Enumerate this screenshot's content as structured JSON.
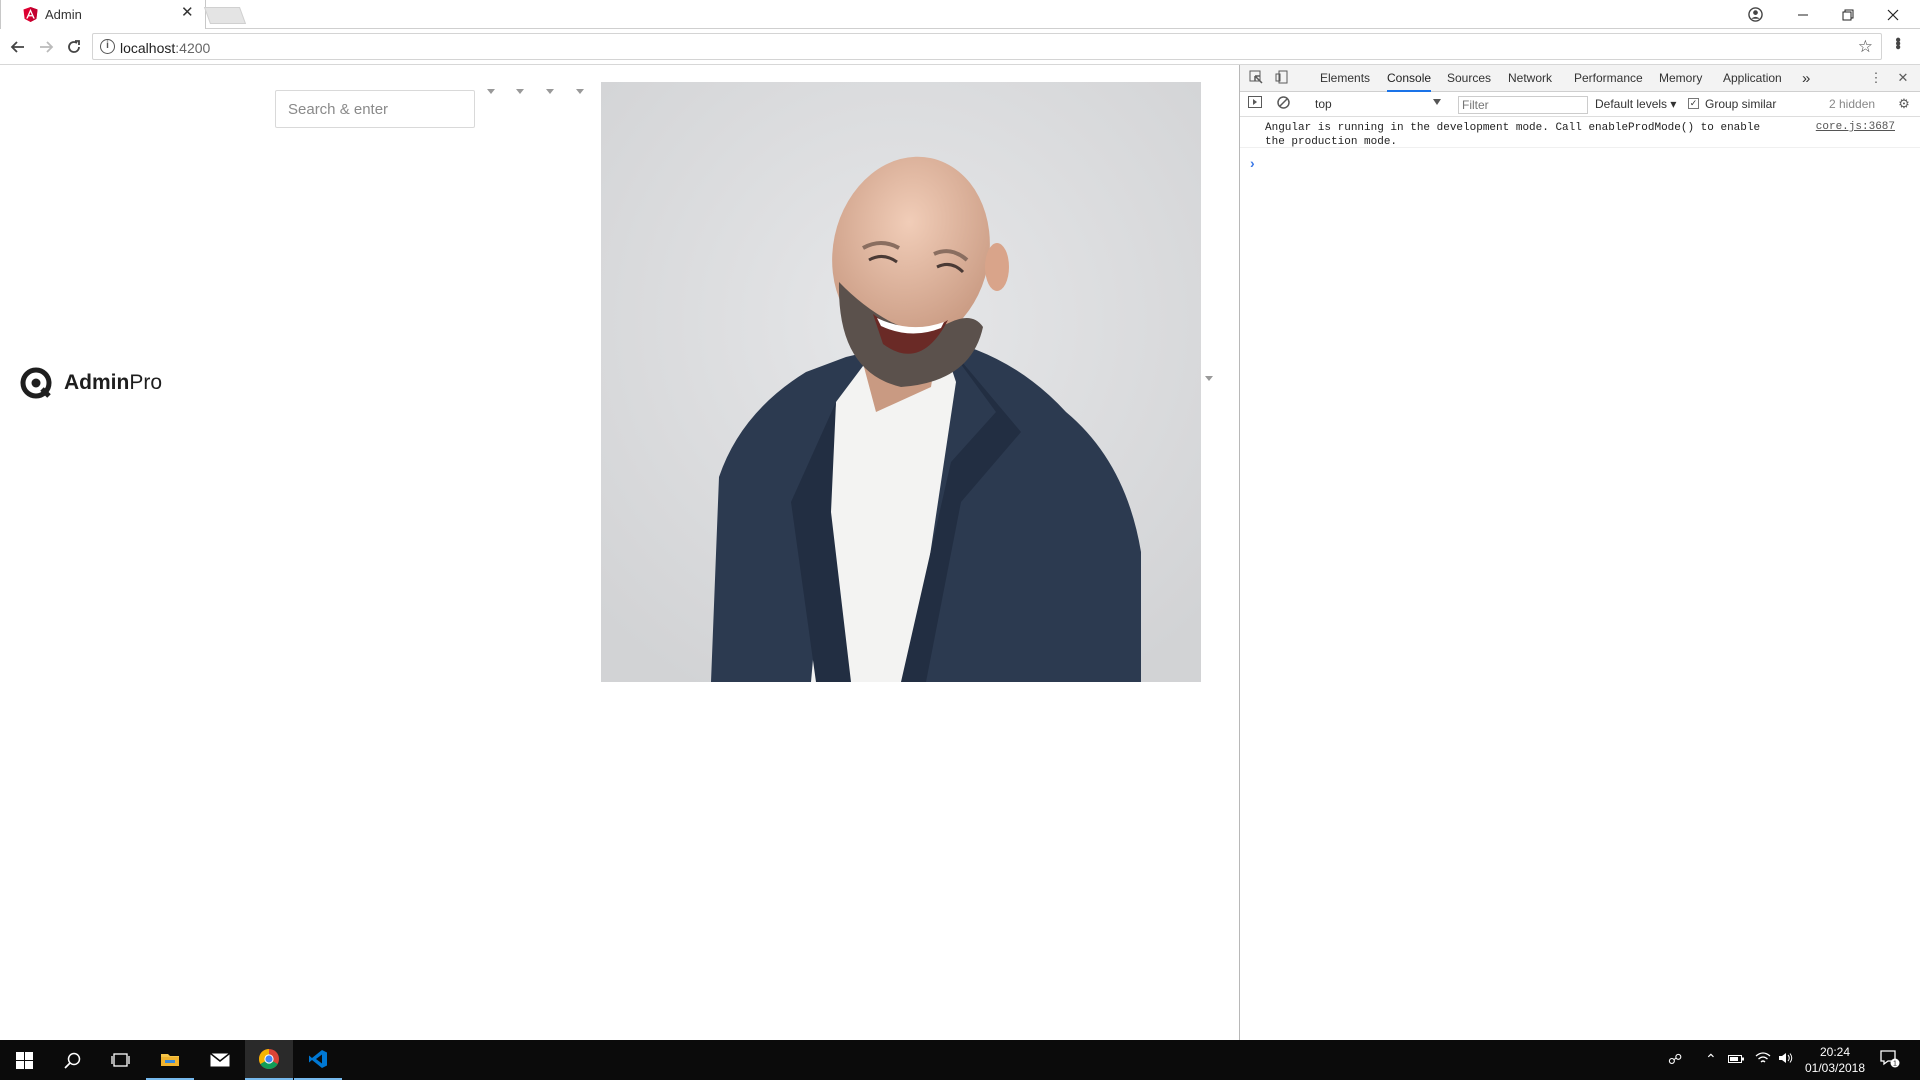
{
  "browser": {
    "tab": {
      "title": "Admin"
    },
    "address": {
      "host": "localhost",
      "port": ":4200"
    }
  },
  "page": {
    "logo": {
      "bold": "Admin",
      "regular": "Pro"
    },
    "search": {
      "placeholder": "Search & enter"
    }
  },
  "devtools": {
    "tabs": [
      "Elements",
      "Console",
      "Sources",
      "Network",
      "Performance",
      "Memory",
      "Application"
    ],
    "active_tab": "Console",
    "more_tabs": "»",
    "context": "top",
    "filter_placeholder": "Filter",
    "levels": "Default levels",
    "group_similar": "Group similar",
    "hidden_count": "2 hidden",
    "messages": [
      {
        "text": "Angular is running in the development mode. Call enableProdMode() to enable the production mode.",
        "source": "core.js:3687"
      }
    ],
    "prompt": "›"
  },
  "taskbar": {
    "time": "20:24",
    "date": "01/03/2018",
    "notification_count": "1"
  },
  "colors": {
    "angular_red": "#dd0031",
    "devtools_accent": "#1a73e8",
    "taskbar_bg": "#0b0b0b",
    "vscode_blue": "#0078d4"
  }
}
